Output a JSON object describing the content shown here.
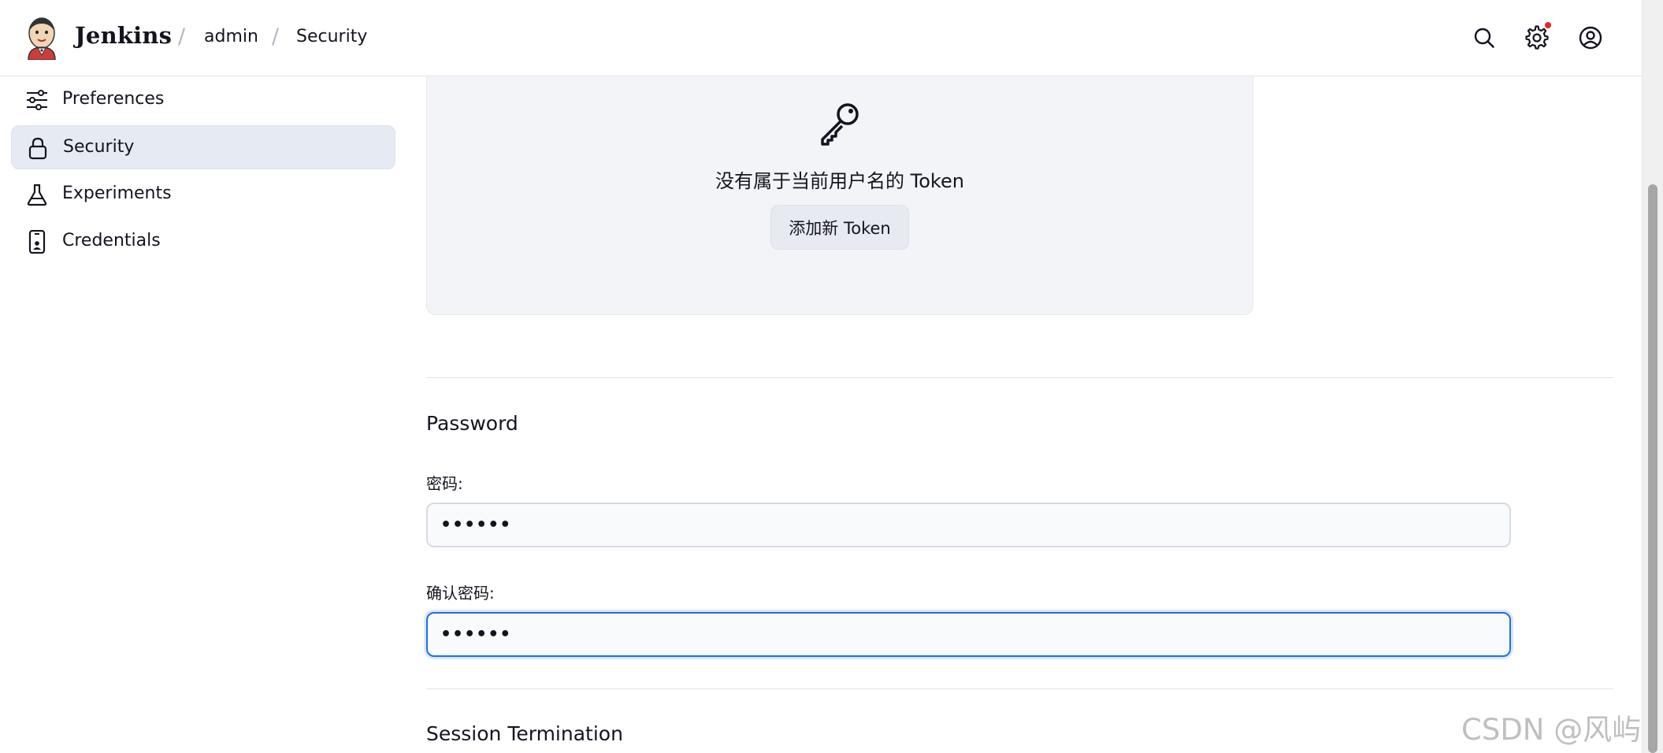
{
  "header": {
    "brand": "Jenkins",
    "breadcrumb": [
      "admin",
      "Security"
    ],
    "separator": "/"
  },
  "sidebar": {
    "items": [
      {
        "label": "Preferences",
        "icon": "sliders-icon",
        "active": false
      },
      {
        "label": "Security",
        "icon": "lock-icon",
        "active": true
      },
      {
        "label": "Experiments",
        "icon": "flask-icon",
        "active": false
      },
      {
        "label": "Credentials",
        "icon": "device-id-icon",
        "active": false
      }
    ]
  },
  "token": {
    "empty_message": "没有属于当前用户名的 Token",
    "add_button": "添加新 Token",
    "icon": "key-icon"
  },
  "password": {
    "section_title": "Password",
    "password_label": "密码:",
    "password_value": "••••••",
    "confirm_label": "确认密码:",
    "confirm_value": "••••••"
  },
  "session": {
    "section_title": "Session Termination"
  },
  "watermark": "CSDN @风屿.",
  "colors": {
    "accent": "#1f6ee8",
    "notification": "#ee2222",
    "active_item_bg": "#e6eaf2",
    "card_bg": "#f2f4f8"
  }
}
